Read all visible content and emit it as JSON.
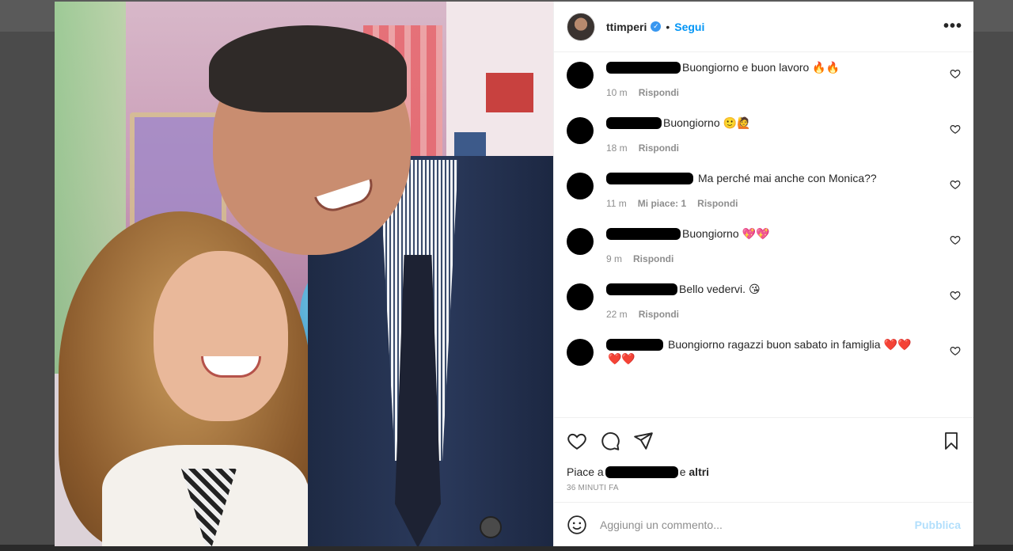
{
  "post": {
    "username": "ttimperi",
    "verified_icon": "verified-badge-icon",
    "follow_label": "Segui",
    "more_label": "•••"
  },
  "comments": [
    {
      "text": "Buongiorno e buon lavoro",
      "emoji": "🔥🔥",
      "time": "10 m",
      "reply": "Rispondi"
    },
    {
      "text": "Buongiorno",
      "emoji": "🙂🙋",
      "time": "18 m",
      "reply": "Rispondi"
    },
    {
      "text": "Ma perché mai anche con Monica??",
      "emoji": "",
      "time": "11 m",
      "likes": "Mi piace: 1",
      "reply": "Rispondi"
    },
    {
      "text": "Buongiorno",
      "emoji": "💖💖",
      "time": "9 m",
      "reply": "Rispondi"
    },
    {
      "text": "Bello vedervi.",
      "emoji": "😘",
      "time": "22 m",
      "reply": "Rispondi"
    },
    {
      "text": "Buongiorno ragazzi buon sabato in famiglia",
      "emoji": "❤️❤️",
      "emoji2": "❤️❤️",
      "time": "",
      "reply": ""
    }
  ],
  "likes": {
    "prefix": "Piace a",
    "suffix_and": "e",
    "suffix_others": "altri"
  },
  "timestamp": "36 MINUTI FA",
  "add_comment": {
    "placeholder": "Aggiungi un commento...",
    "publish": "Pubblica"
  },
  "colors": {
    "link": "#0095f6",
    "publish_disabled": "#b2dffc",
    "text": "#262626",
    "muted": "#8e8e8e"
  }
}
